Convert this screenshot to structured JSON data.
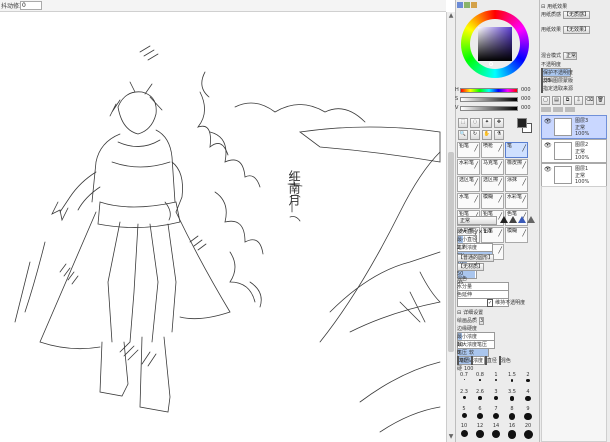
{
  "topbar": {
    "label": "抖动修正",
    "value": "0"
  },
  "canvas": {
    "signature": "红南月"
  },
  "color_panel": {
    "accent": "#4b3c8a",
    "fg_color": "#222222",
    "bg_color": "#ffffff",
    "slider_labels": [
      "H",
      "S",
      "V"
    ],
    "slider_values": [
      "000",
      "000",
      "000"
    ]
  },
  "tool_buttons": [
    {
      "label": "铅笔"
    },
    {
      "label": "喷枪"
    },
    {
      "label": "笔"
    },
    {
      "label": "水彩笔"
    },
    {
      "label": "马克笔"
    },
    {
      "label": "橡皮擦"
    },
    {
      "label": "选区笔"
    },
    {
      "label": "选区擦"
    },
    {
      "label": "涂抹"
    },
    {
      "label": "水笔"
    },
    {
      "label": "模糊"
    },
    {
      "label": "水彩笔"
    },
    {
      "label": "铅笔"
    },
    {
      "label": "铅笔"
    },
    {
      "label": "色笔"
    },
    {
      "label": "水彩笔"
    },
    {
      "label": "铅笔"
    },
    {
      "label": "模糊"
    },
    {
      "label": "黑笔"
    },
    {
      "label": "橡皮"
    }
  ],
  "brush_settings": {
    "blend_mode": "正常",
    "max_size_label": "最大直径",
    "max_size_value": "x 1.0",
    "max_size_num": "2.7",
    "min_size_label": "最小直径",
    "min_size_value": "0%",
    "density_label": "笔刷浓度",
    "density_value": "100",
    "shape_label": "【普通的圆形】",
    "shape_value": "50",
    "texture_label": "【无材质】",
    "texture_value": "95",
    "blend_label": "混色",
    "blend_value": "",
    "water_label": "水分量",
    "water_value": "",
    "colorext_label": "色延伸",
    "colorext_value": "",
    "keep_opacity_label": "维持不透明度",
    "detail_label": "详细设置",
    "quality_label": "绘画品质",
    "quality_value": "3",
    "edge_label": "边缘硬度",
    "edge_value": "10",
    "min_density_label": "最小浓度",
    "min_density_value": "0",
    "max_pressure_label": "最大浓度笔压",
    "max_pressure_value": "100%",
    "pressure_label": "笔压",
    "pressure_soft": "软",
    "pressure_hard": "硬",
    "pressure_value": "100",
    "pressure_checks": [
      "笔压",
      "浓度",
      "直径",
      "混色"
    ],
    "size_presets_row1": [
      "0.7",
      "0.8",
      "1",
      "1.5",
      "2"
    ],
    "size_presets_row2": [
      "2.3",
      "2.6",
      "3",
      "3.5",
      "4"
    ],
    "size_presets_row3": [
      "5",
      "6",
      "7",
      "8",
      "9"
    ],
    "size_presets_row4": [
      "10",
      "12",
      "14",
      "16",
      "20"
    ]
  },
  "layer_panel": {
    "paper_effect_label": "用纸质感",
    "paper_effect_value": "【无质感】",
    "paper_effect2_label": "用纸效果",
    "paper_effect2_value": "【无效果】",
    "blend_label": "混合模式",
    "blend_value": "正常",
    "opacity_label": "不透明度",
    "opacity_value": "100",
    "checks": [
      "保护不透明度",
      "剪辑图层蒙版",
      "指定选取来源"
    ],
    "layers": [
      {
        "name": "图层3",
        "mode": "正常",
        "opacity": "100%",
        "selected": true
      },
      {
        "name": "图层2",
        "mode": "正常",
        "opacity": "100%",
        "selected": false
      },
      {
        "name": "图层1",
        "mode": "正常",
        "opacity": "100%",
        "selected": false
      }
    ]
  }
}
